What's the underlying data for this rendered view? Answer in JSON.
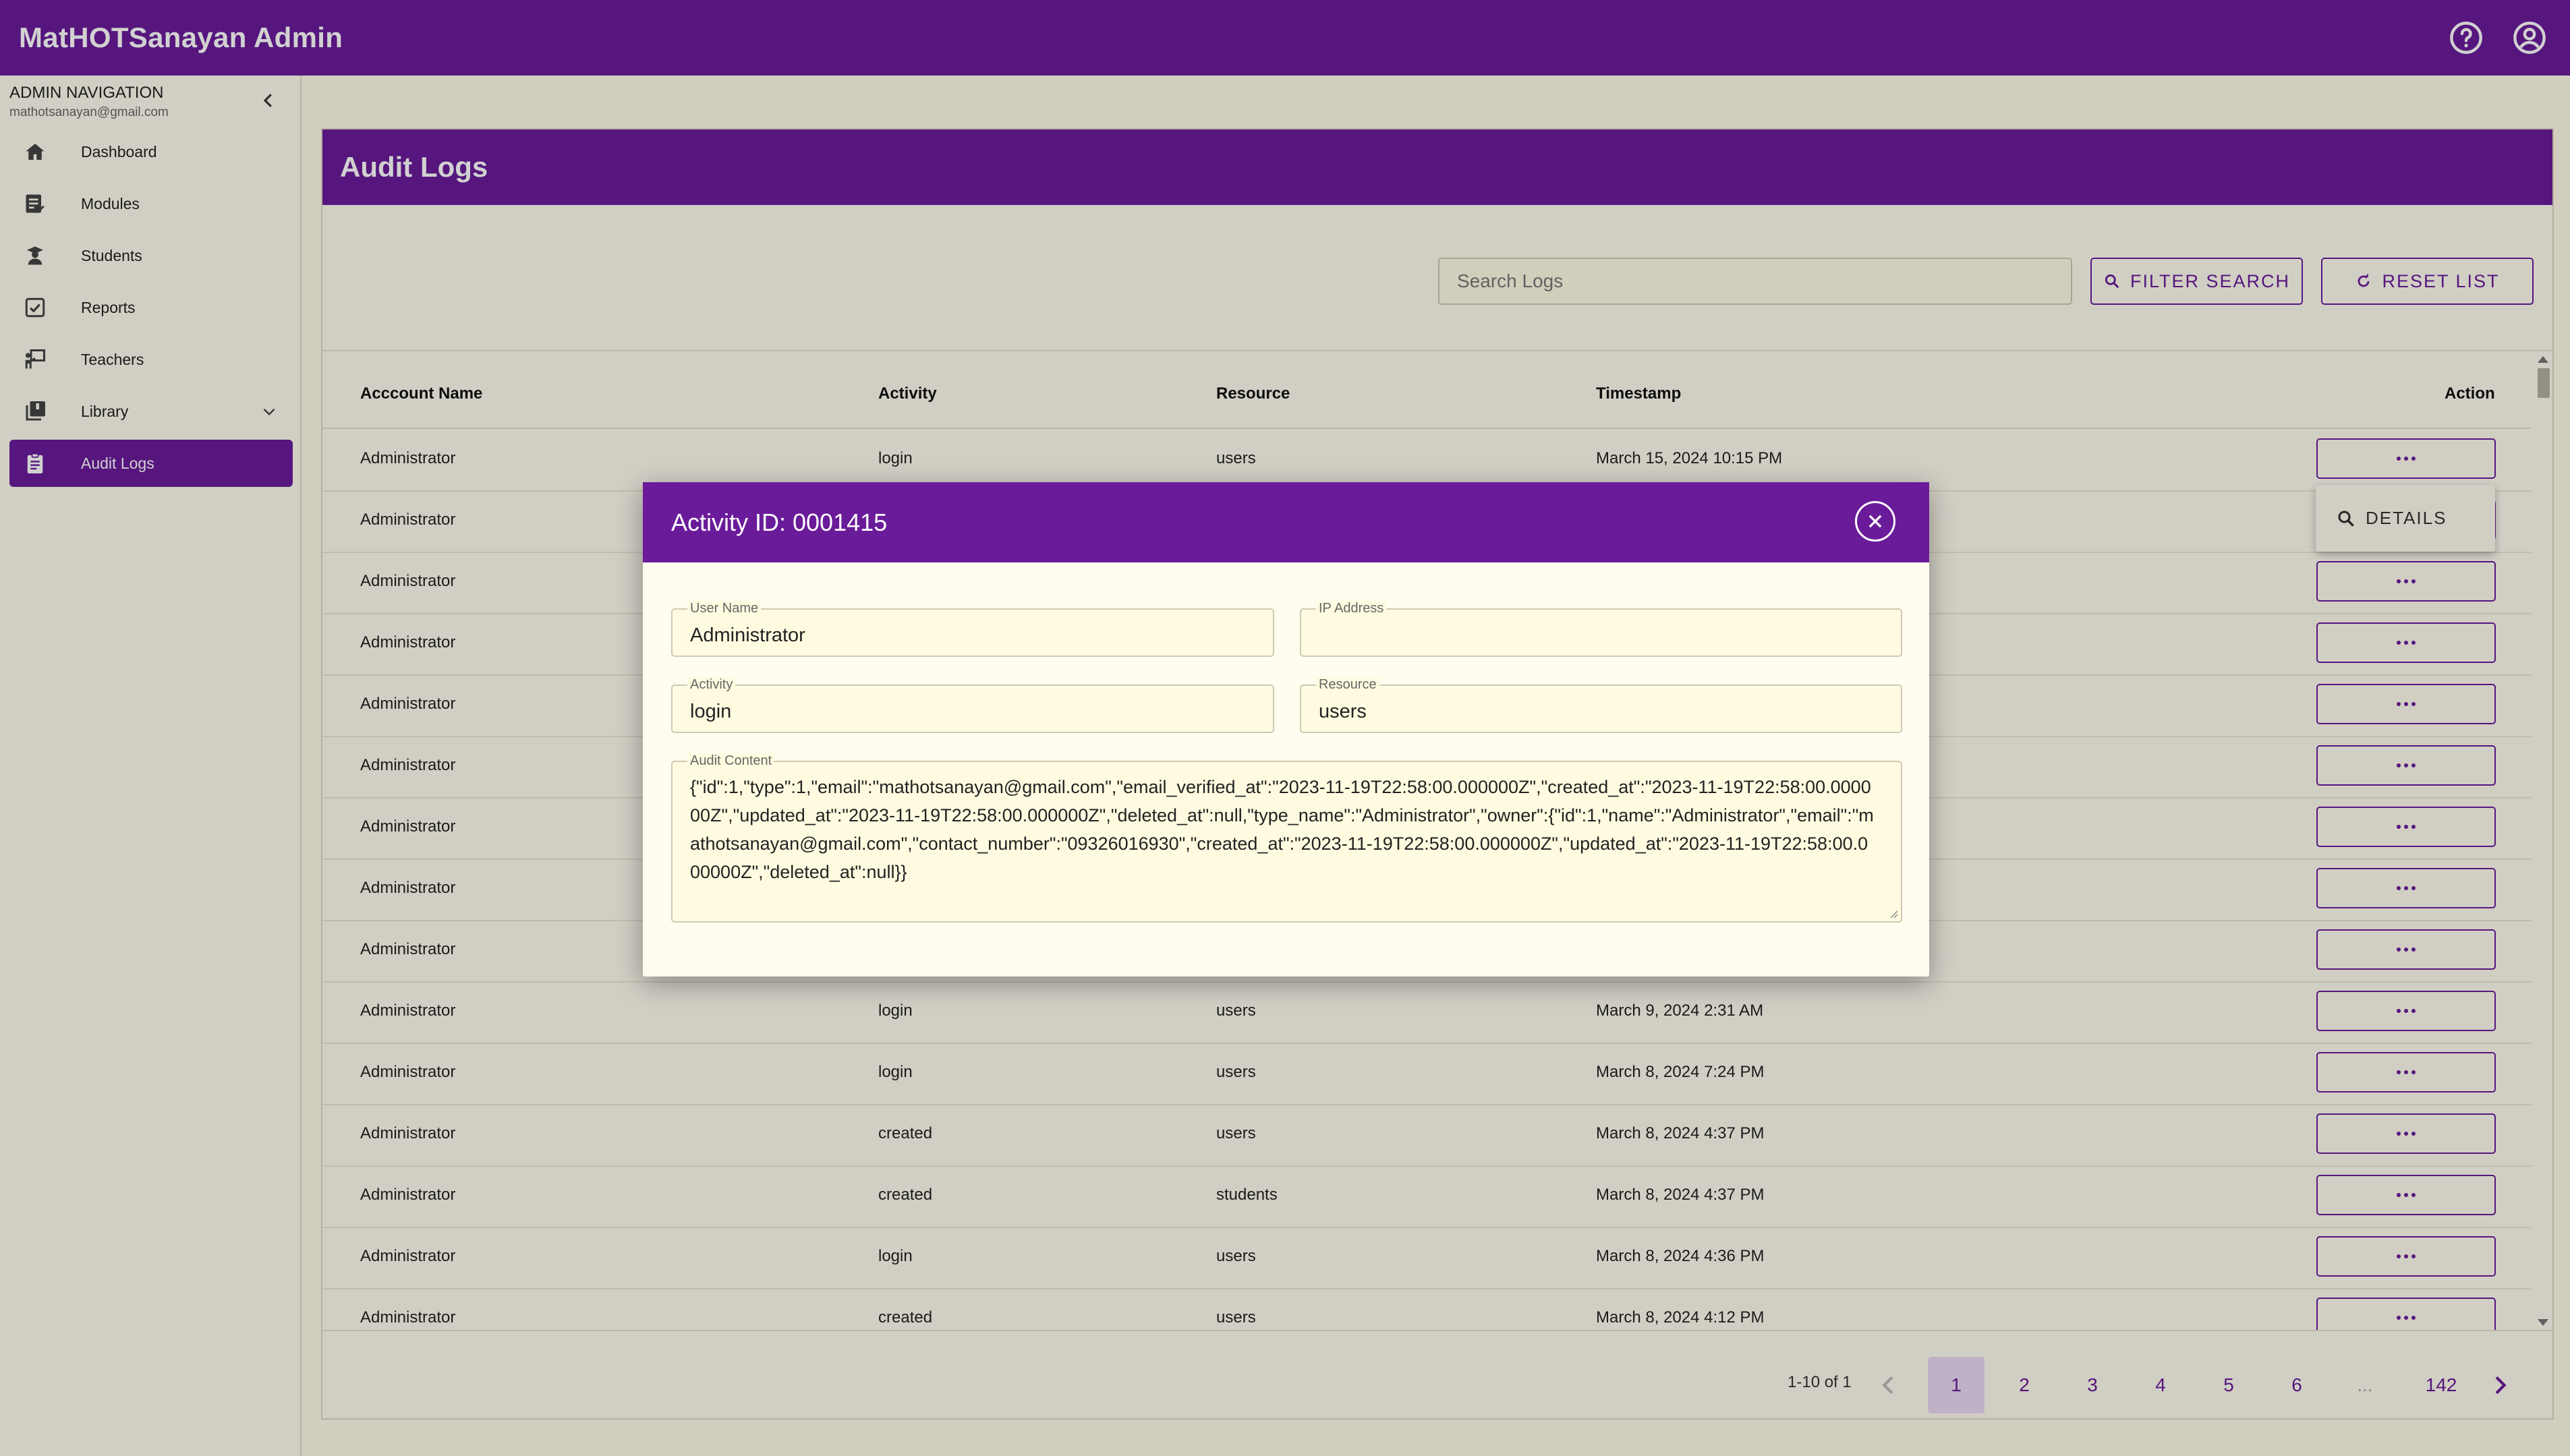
{
  "app": {
    "title": "MatHOTSanayan Admin",
    "icons": [
      "help-icon",
      "account-icon"
    ]
  },
  "colors": {
    "primary": "#6a1b9a",
    "background": "#fffceb"
  },
  "sidebar": {
    "heading": "ADMIN NAVIGATION",
    "email": "mathotsanayan@gmail.com",
    "items": [
      {
        "label": "Dashboard",
        "icon": "home-icon"
      },
      {
        "label": "Modules",
        "icon": "modules-icon"
      },
      {
        "label": "Students",
        "icon": "students-icon"
      },
      {
        "label": "Reports",
        "icon": "reports-icon"
      },
      {
        "label": "Teachers",
        "icon": "teachers-icon"
      },
      {
        "label": "Library",
        "icon": "library-icon"
      },
      {
        "label": "Audit Logs",
        "icon": "audit-logs-icon",
        "active": true
      }
    ]
  },
  "main": {
    "title": "Audit Logs",
    "search": {
      "placeholder": "Search Logs",
      "value": ""
    },
    "filter_label": "FILTER SEARCH",
    "reset_label": "RESET LIST",
    "table": {
      "headers": [
        "Acccount Name",
        "Activity",
        "Resource",
        "Timestamp",
        "Action"
      ],
      "rows": [
        [
          "Administrator",
          "login",
          "users",
          "March 15, 2024 10:15 PM"
        ],
        [
          "Administrator",
          "",
          "",
          ""
        ],
        [
          "Administrator",
          "",
          "",
          ""
        ],
        [
          "Administrator",
          "",
          "",
          ""
        ],
        [
          "Administrator",
          "",
          "",
          ""
        ],
        [
          "Administrator",
          "",
          "",
          ""
        ],
        [
          "Administrator",
          "",
          "",
          ""
        ],
        [
          "Administrator",
          "",
          "",
          ""
        ],
        [
          "Administrator",
          "",
          "",
          ""
        ],
        [
          "Administrator",
          "login",
          "users",
          "March 9, 2024 2:31 AM"
        ],
        [
          "Administrator",
          "login",
          "users",
          "March 8, 2024 7:24 PM"
        ],
        [
          "Administrator",
          "created",
          "users",
          "March 8, 2024 4:37 PM"
        ],
        [
          "Administrator",
          "created",
          "students",
          "March 8, 2024 4:37 PM"
        ],
        [
          "Administrator",
          "login",
          "users",
          "March 8, 2024 4:36 PM"
        ],
        [
          "Administrator",
          "created",
          "users",
          "March 8, 2024 4:12 PM"
        ]
      ]
    },
    "action_menu": {
      "details_label": "DETAILS"
    },
    "pagination": {
      "info": "1-10 of 1",
      "pages": [
        "1",
        "2",
        "3",
        "4",
        "5",
        "6",
        "...",
        "142"
      ],
      "current": "1"
    }
  },
  "modal": {
    "title": "Activity ID: 0001415",
    "user_name": {
      "label": "User Name",
      "value": "Administrator"
    },
    "ip_address": {
      "label": "IP Address",
      "value": ""
    },
    "activity": {
      "label": "Activity",
      "value": "login"
    },
    "resource": {
      "label": "Resource",
      "value": "users"
    },
    "audit_content": {
      "label": "Audit Content",
      "value": "{\"id\":1,\"type\":1,\"email\":\"mathotsanayan@gmail.com\",\"email_verified_at\":\"2023-11-19T22:58:00.000000Z\",\"created_at\":\"2023-11-19T22:58:00.000000Z\",\"updated_at\":\"2023-11-19T22:58:00.000000Z\",\"deleted_at\":null,\"type_name\":\"Administrator\",\"owner\":{\"id\":1,\"name\":\"Administrator\",\"email\":\"mathotsanayan@gmail.com\",\"contact_number\":\"09326016930\",\"created_at\":\"2023-11-19T22:58:00.000000Z\",\"updated_at\":\"2023-11-19T22:58:00.000000Z\",\"deleted_at\":null}}"
    }
  }
}
